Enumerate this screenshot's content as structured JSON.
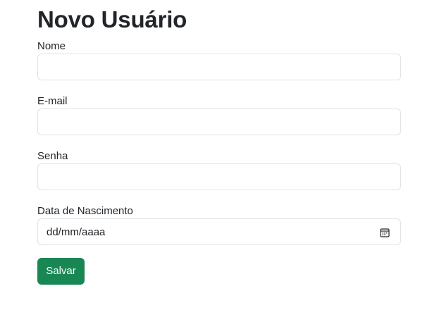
{
  "page": {
    "title": "Novo Usuário"
  },
  "form": {
    "fields": [
      {
        "label": "Nome",
        "value": "",
        "placeholder": ""
      },
      {
        "label": "E-mail",
        "value": "",
        "placeholder": ""
      },
      {
        "label": "Senha",
        "value": "",
        "placeholder": ""
      },
      {
        "label": "Data de Nascimento",
        "value": "",
        "placeholder": "dd/mm/aaaa",
        "icon": "calendar-icon"
      }
    ],
    "submit_label": "Salvar"
  },
  "colors": {
    "primary_button": "#198754",
    "input_border": "#dee2e6",
    "text": "#212529"
  }
}
